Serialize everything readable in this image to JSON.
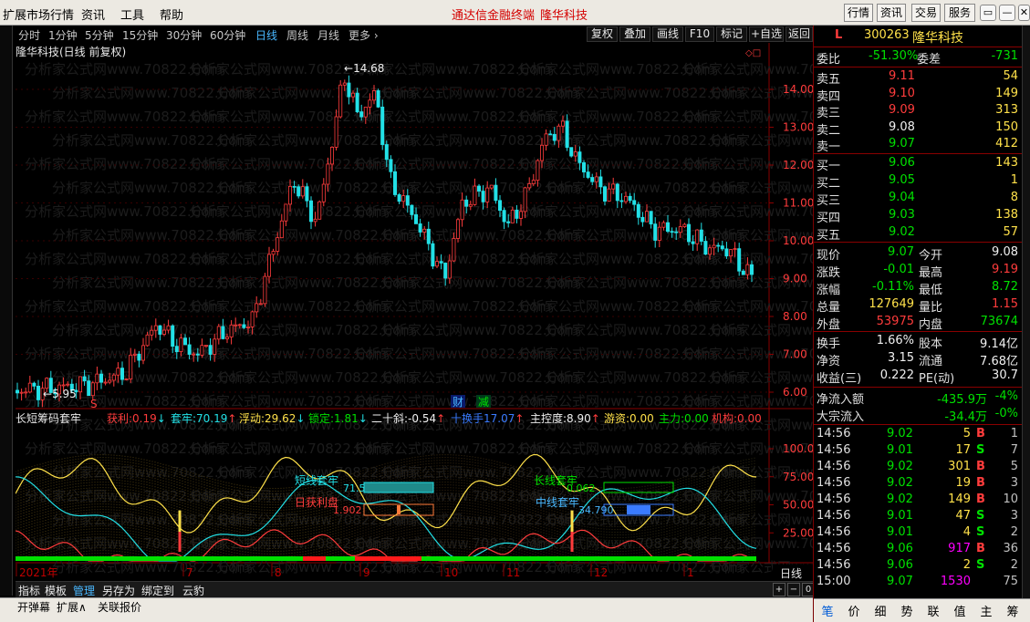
{
  "menu": {
    "items": [
      "扩展市场行情",
      "资讯",
      "工具",
      "帮助"
    ],
    "app_title": "通达信金融终端",
    "stock_title": "隆华科技",
    "buttons": [
      "行情",
      "资讯",
      "交易",
      "服务"
    ],
    "window_buttons": [
      "▭",
      "—",
      "✕"
    ]
  },
  "periods": {
    "items": [
      "分时",
      "1分钟",
      "5分钟",
      "15分钟",
      "30分钟",
      "60分钟",
      "日线",
      "周线",
      "月线",
      "更多 ›"
    ],
    "active": "日线",
    "right_buttons": [
      "复权",
      "叠加",
      "画线",
      "F10",
      "标记",
      "+自选",
      "返回"
    ]
  },
  "chart": {
    "stock_label": "隆华科技(日线 前复权)",
    "watermark": "分析家公式网www.70822.Com",
    "high_marker": "14.68",
    "low_marker": "5.95",
    "price_axis": [
      "14.00",
      "13.00",
      "12.00",
      "11.00",
      "10.00",
      "9.00",
      "8.00",
      "7.00",
      "6.00"
    ],
    "markers": {
      "cai": "财",
      "jian": "减",
      "s": "S"
    },
    "colors": {
      "up": "#ff3c3c",
      "down": "#22e0e6",
      "grid": "#7a0000"
    }
  },
  "indicator": {
    "name": "长短筹码套牢",
    "fields": [
      {
        "label": "获利:",
        "value": "0.19",
        "arrow": "↓",
        "label_color": "#ff3c3c",
        "value_color": "#ff3c3c"
      },
      {
        "label": "套牢:",
        "value": "70.19",
        "arrow": "↑",
        "label_color": "#22e0e6",
        "value_color": "#22e0e6"
      },
      {
        "label": "浮动:",
        "value": "29.62",
        "arrow": "↓",
        "label_color": "#ffe14a",
        "value_color": "#ffe14a"
      },
      {
        "label": "锁定:",
        "value": "1.81",
        "arrow": "↓",
        "label_color": "#00e000",
        "value_color": "#00e000"
      },
      {
        "label": "二十斜:",
        "value": "-0.54",
        "arrow": "↑",
        "label_color": "#f0f0f0",
        "value_color": "#f0f0f0"
      },
      {
        "label": "十换手",
        "value": "17.07",
        "arrow": "↑",
        "label_color": "#3a7bff",
        "value_color": "#3a7bff"
      },
      {
        "label": "主控度:",
        "value": "8.90",
        "arrow": "↑",
        "label_color": "#f0f0f0",
        "value_color": "#f0f0f0"
      },
      {
        "label": "游资:",
        "value": "0.00",
        "arrow": "",
        "label_color": "#ffe14a",
        "value_color": "#ffe14a"
      },
      {
        "label": "主力:",
        "value": "0.00",
        "arrow": "",
        "label_color": "#00e000",
        "value_color": "#00e000"
      },
      {
        "label": "机构:",
        "value": "0.00",
        "arrow": "",
        "label_color": "#ff3c3c",
        "value_color": "#ff3c3c"
      }
    ],
    "y_axis": [
      "100.00",
      "75.00",
      "50.00",
      "25.00"
    ],
    "labels": {
      "short_trap": "短线套牢",
      "short_trap_val": "71.591",
      "short_profit": "日获利盘",
      "short_profit_val": "1.902",
      "long_trap": "长线套牢",
      "long_trap_val": "0.062",
      "mid_trap": "中线套牢",
      "mid_trap_val": "34.790"
    }
  },
  "date_axis": {
    "labels": [
      "2021年",
      "7",
      "8",
      "9",
      "10",
      "11",
      "12",
      "1"
    ],
    "period_label": "日线"
  },
  "tabs": {
    "items": [
      "指标",
      "模板",
      "管理",
      "另存为",
      "绑定到",
      "云豹"
    ],
    "active": "管理",
    "nav": [
      "+",
      "−",
      "0"
    ]
  },
  "bottom": {
    "items": [
      "开弹幕",
      "扩展∧",
      "关联报价"
    ]
  },
  "quote": {
    "flag": "L",
    "code": "300263",
    "name": "隆华科技",
    "weibi_label": "委比",
    "weibi": "-51.30%",
    "weicha_label": "委差",
    "weicha": "-731",
    "asks": [
      {
        "label": "卖五",
        "price": "9.11",
        "vol": "54",
        "color": "red"
      },
      {
        "label": "卖四",
        "price": "9.10",
        "vol": "149",
        "color": "red"
      },
      {
        "label": "卖三",
        "price": "9.09",
        "vol": "313",
        "color": "red"
      },
      {
        "label": "卖二",
        "price": "9.08",
        "vol": "150",
        "color": "white"
      },
      {
        "label": "卖一",
        "price": "9.07",
        "vol": "412",
        "color": "green"
      }
    ],
    "bids": [
      {
        "label": "买一",
        "price": "9.06",
        "vol": "143",
        "color": "green"
      },
      {
        "label": "买二",
        "price": "9.05",
        "vol": "1",
        "color": "green"
      },
      {
        "label": "买三",
        "price": "9.04",
        "vol": "8",
        "color": "green"
      },
      {
        "label": "买四",
        "price": "9.03",
        "vol": "138",
        "color": "green"
      },
      {
        "label": "买五",
        "price": "9.02",
        "vol": "57",
        "color": "green"
      }
    ],
    "stats": [
      {
        "l1": "现价",
        "v1": "9.07",
        "c1": "green",
        "l2": "今开",
        "v2": "9.08",
        "c2": "white"
      },
      {
        "l1": "涨跌",
        "v1": "-0.01",
        "c1": "green",
        "l2": "最高",
        "v2": "9.19",
        "c2": "red"
      },
      {
        "l1": "涨幅",
        "v1": "-0.11%",
        "c1": "green",
        "l2": "最低",
        "v2": "8.72",
        "c2": "green"
      },
      {
        "l1": "总量",
        "v1": "127649",
        "c1": "yellow",
        "l2": "量比",
        "v2": "1.15",
        "c2": "red"
      },
      {
        "l1": "外盘",
        "v1": "53975",
        "c1": "red",
        "l2": "内盘",
        "v2": "73674",
        "c2": "green"
      }
    ],
    "stats2": [
      {
        "l1": "换手",
        "v1": "1.66%",
        "c1": "white",
        "l2": "股本",
        "v2": "9.14亿",
        "c2": "white"
      },
      {
        "l1": "净资",
        "v1": "3.15",
        "c1": "white",
        "l2": "流通",
        "v2": "7.68亿",
        "c2": "white"
      },
      {
        "l1": "收益(三)",
        "v1": "0.222",
        "c1": "white",
        "l2": "PE(动)",
        "v2": "30.7",
        "c2": "white"
      }
    ],
    "flows": [
      {
        "label": "净流入额",
        "value": "-435.9万",
        "pct": "-4%"
      },
      {
        "label": "大宗流入",
        "value": "-34.4万",
        "pct": "-0%"
      }
    ],
    "ticks": [
      {
        "time": "14:56",
        "price": "9.02",
        "vol": "5",
        "bs": "B",
        "n": "1",
        "pc": "green",
        "vc": "yellow",
        "bc": "red"
      },
      {
        "time": "14:56",
        "price": "9.01",
        "vol": "17",
        "bs": "S",
        "n": "7",
        "pc": "green",
        "vc": "yellow",
        "bc": "green"
      },
      {
        "time": "14:56",
        "price": "9.02",
        "vol": "301",
        "bs": "B",
        "n": "5",
        "pc": "green",
        "vc": "yellow",
        "bc": "red"
      },
      {
        "time": "14:56",
        "price": "9.02",
        "vol": "19",
        "bs": "B",
        "n": "3",
        "pc": "green",
        "vc": "yellow",
        "bc": "red"
      },
      {
        "time": "14:56",
        "price": "9.02",
        "vol": "149",
        "bs": "B",
        "n": "10",
        "pc": "green",
        "vc": "yellow",
        "bc": "red"
      },
      {
        "time": "14:56",
        "price": "9.01",
        "vol": "47",
        "bs": "S",
        "n": "3",
        "pc": "green",
        "vc": "yellow",
        "bc": "green"
      },
      {
        "time": "14:56",
        "price": "9.01",
        "vol": "4",
        "bs": "S",
        "n": "2",
        "pc": "green",
        "vc": "yellow",
        "bc": "green"
      },
      {
        "time": "14:56",
        "price": "9.06",
        "vol": "917",
        "bs": "B",
        "n": "36",
        "pc": "green",
        "vc": "magenta",
        "bc": "red"
      },
      {
        "time": "14:56",
        "price": "9.06",
        "vol": "2",
        "bs": "S",
        "n": "2",
        "pc": "green",
        "vc": "yellow",
        "bc": "green"
      },
      {
        "time": "15:00",
        "price": "9.07",
        "vol": "1530",
        "bs": "",
        "n": "75",
        "pc": "green",
        "vc": "magenta",
        "bc": "gray"
      }
    ],
    "bottom_tabs": [
      "笔",
      "价",
      "细",
      "势",
      "联",
      "值",
      "主",
      "筹"
    ],
    "bottom_tab_active": "笔"
  }
}
